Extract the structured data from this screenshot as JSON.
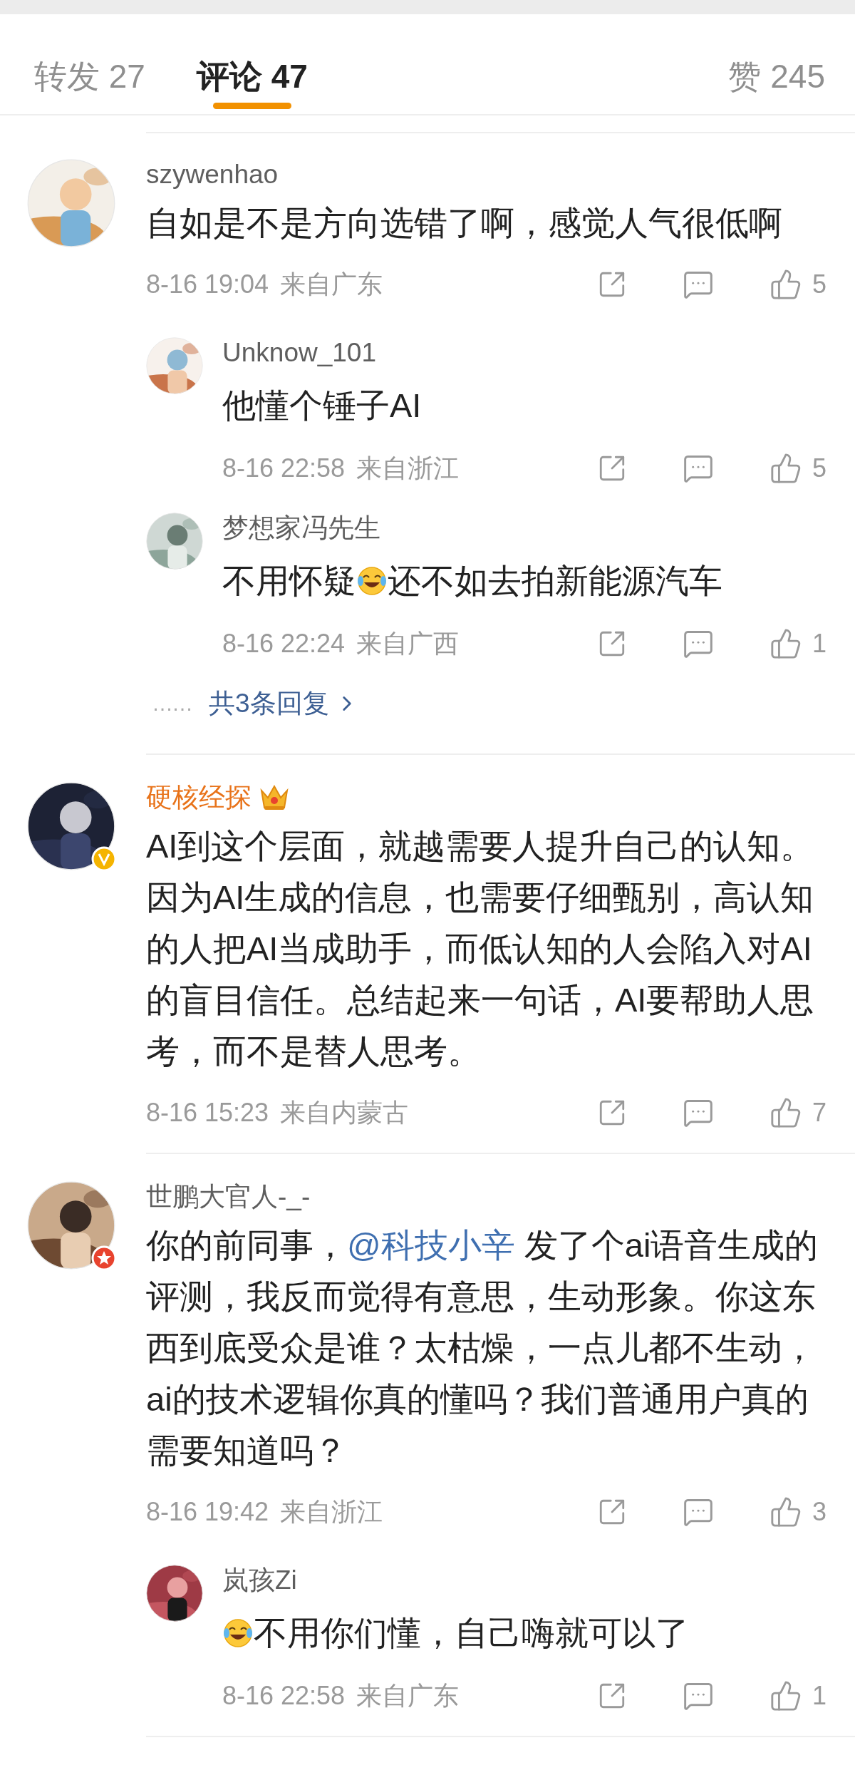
{
  "tabs": [
    {
      "label": "转发 27",
      "selected": false
    },
    {
      "label": "评论 47",
      "selected": true
    },
    {
      "label": "赞 245",
      "selected": false
    }
  ],
  "comments": [
    {
      "name": "szywenhao",
      "vip": false,
      "body": [
        {
          "kind": "text",
          "text": "自如是不是方向选错了啊，感觉人气很低啊"
        }
      ],
      "time": "8-16 19:04",
      "location": "来自广东",
      "likes": "5",
      "replies": [
        {
          "name": "Unknow_101",
          "vip": false,
          "body": [
            {
              "kind": "text",
              "text": "他懂个锤子AI"
            }
          ],
          "time": "8-16 22:58",
          "location": "来自浙江",
          "likes": "5"
        },
        {
          "name": "梦想家冯先生",
          "vip": false,
          "body": [
            {
              "kind": "text",
              "text": "不用怀疑"
            },
            {
              "kind": "emoji"
            },
            {
              "kind": "text",
              "text": "还不如去拍新能源汽车"
            }
          ],
          "time": "8-16 22:24",
          "location": "来自广西",
          "likes": "1"
        }
      ],
      "more_replies": {
        "dots": "……",
        "label": "共3条回复"
      }
    },
    {
      "name": "硬核经探",
      "vip": true,
      "verified": true,
      "body": [
        {
          "kind": "text",
          "text": "AI到这个层面，就越需要人提升自己的认知。因为AI生成的信息，也需要仔细甄别，高认知的人把AI当成助手，而低认知的人会陷入对AI的盲目信任。总结起来一句话，AI要帮助人思考，而不是替人思考。"
        }
      ],
      "time": "8-16 15:23",
      "location": "来自内蒙古",
      "likes": "7"
    },
    {
      "name": "世鹏大官人-_-",
      "vip": false,
      "starred": true,
      "body": [
        {
          "kind": "text",
          "text": "你的前同事，"
        },
        {
          "kind": "link",
          "text": "@科技小辛"
        },
        {
          "kind": "text",
          "text": " 发了个ai语音生成的评测，我反而觉得有意思，生动形象。你这东西到底受众是谁？太枯燥，一点儿都不生动，ai的技术逻辑你真的懂吗？我们普通用户真的需要知道吗？"
        }
      ],
      "time": "8-16 19:42",
      "location": "来自浙江",
      "likes": "3",
      "replies": [
        {
          "name": "岚孩Zi",
          "vip": false,
          "body": [
            {
              "kind": "emoji"
            },
            {
              "kind": "text",
              "text": "不用你们懂，自己嗨就可以了"
            }
          ],
          "time": "8-16 22:58",
          "location": "来自广东",
          "likes": "1"
        }
      ]
    }
  ]
}
